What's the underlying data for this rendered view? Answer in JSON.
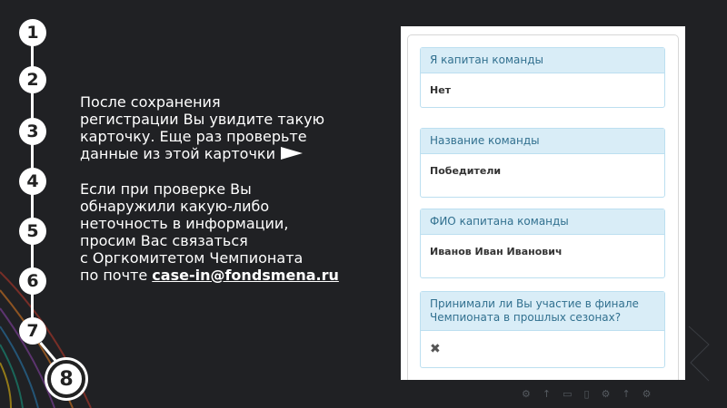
{
  "steps": [
    "1",
    "2",
    "3",
    "4",
    "5",
    "6",
    "7",
    "8"
  ],
  "text": {
    "para1": [
      "После сохранения",
      "регистрации Вы увидите такую",
      "карточку. Еще раз проверьте",
      "данные из этой карточки"
    ],
    "para2": [
      "Если при проверке Вы",
      "обнаружили какую-либо",
      "неточность в информации,",
      "просим Вас связаться",
      "с Оргкомитетом Чемпионата"
    ],
    "email_prefix": "по почте ",
    "email": "case-in@fondsmena.ru"
  },
  "card": {
    "panels": [
      {
        "label": "Я капитан команды",
        "value": "Нет"
      },
      {
        "label": "Название команды",
        "value": "Победители"
      },
      {
        "label": "ФИО капитана команды",
        "value": "Иванов Иван Иванович"
      },
      {
        "label": "Принимали ли Вы участие в финале Чемпионата в прошлых сезонах?",
        "value": "✖"
      }
    ]
  },
  "colors": {
    "background": "#202124",
    "panel_header_bg": "#d9edf7",
    "panel_header_text": "#31708f",
    "panel_border": "#bcdff0"
  },
  "footer_icons": [
    "gear-icon",
    "upload-icon",
    "monitor-icon",
    "phone-icon",
    "gear-icon",
    "upload-icon",
    "gear-icon"
  ],
  "footer_glyphs": [
    "⚙",
    "↑",
    "▭",
    "▯",
    "⚙",
    "↑",
    "⚙"
  ]
}
